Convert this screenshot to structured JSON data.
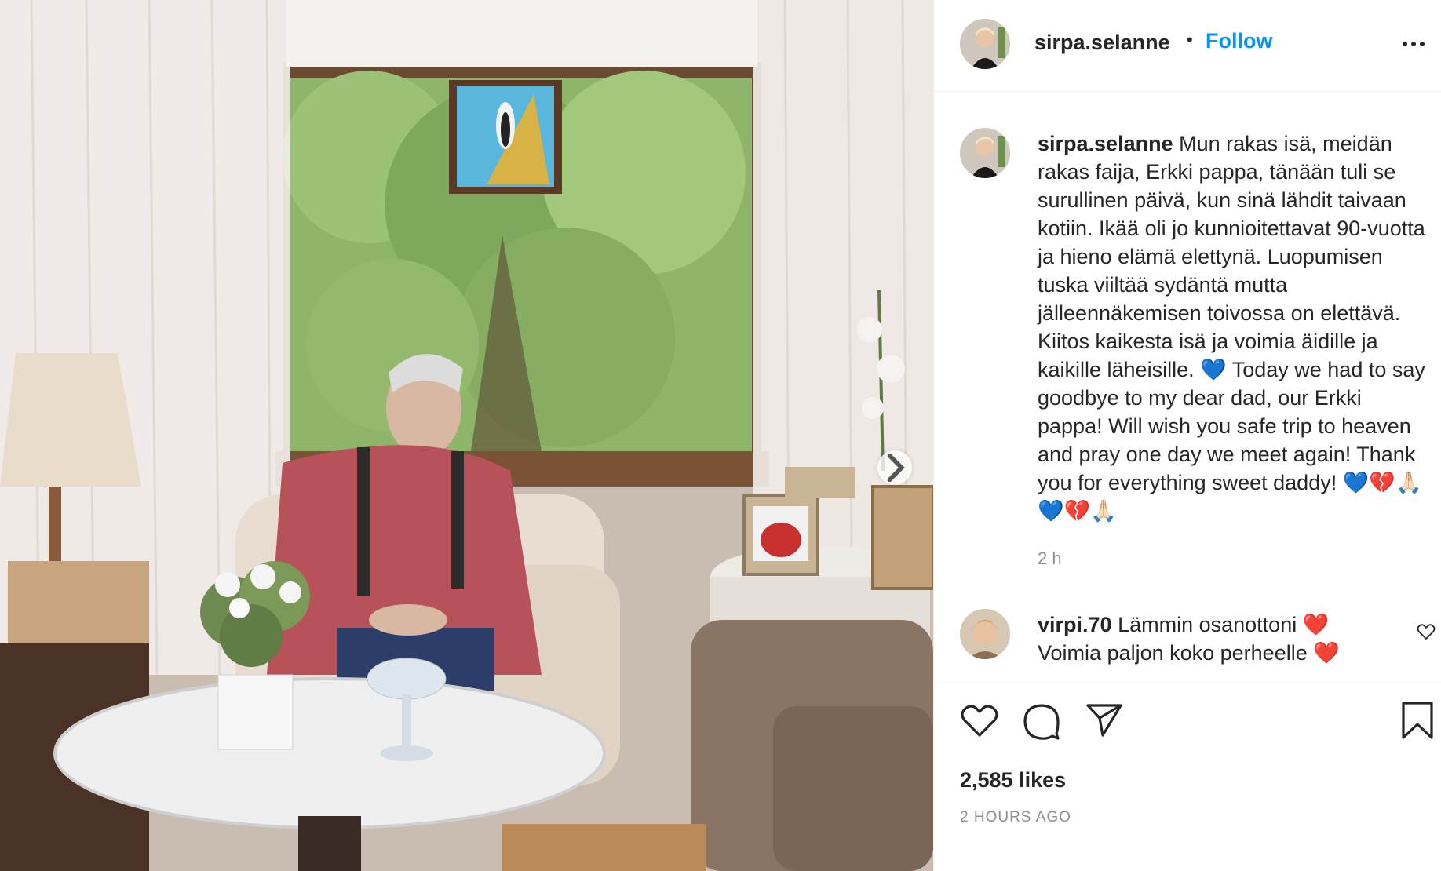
{
  "post": {
    "username": "sirpa.selanne",
    "follow_label": "Follow",
    "separator": "•",
    "caption_username": "sirpa.selanne",
    "caption_text": "Mun rakas isä, meidän rakas faija, Erkki pappa, tänään tuli se surullinen päivä, kun sinä lähdit taivaan kotiin. Ikää oli jo kunnioitettavat 90-vuotta ja hieno elämä elettynä. Luopumisen tuska viiltää sydäntä mutta jälleennäkemisen toivossa on elettävä. Kiitos kaikesta isä ja voimia äidille ja kaikille läheisille. 💙 Today we had to say goodbye to my dear dad, our Erkki pappa! Will wish you safe trip to heaven and pray one day we meet again! Thank you for everything sweet daddy! 💙💔🙏🏻💙💔🙏🏻",
    "caption_time": "2 h",
    "likes": "2,585 likes",
    "time_ago": "2 HOURS AGO"
  },
  "comment": {
    "username": "virpi.70",
    "text": "Lämmin osanottoni ❤️ Voimia paljon koko perheelle ❤️"
  },
  "icons": {
    "more": "more-options-icon",
    "like": "heart-icon",
    "comment": "comment-icon",
    "share": "send-icon",
    "save": "bookmark-icon",
    "next": "chevron-right-icon"
  },
  "colors": {
    "follow": "#0095f6",
    "text": "#262626",
    "muted": "#8e8e8e",
    "divider": "#efefef"
  }
}
